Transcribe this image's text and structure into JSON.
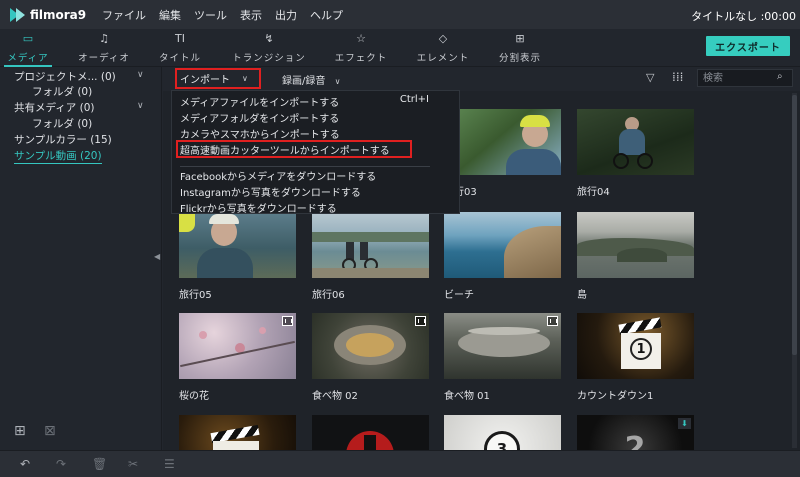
{
  "app": {
    "logo_text": "filmora9",
    "doc_title": "タイトルなし :00:00",
    "menu": [
      "ファイル",
      "編集",
      "ツール",
      "表示",
      "出力",
      "ヘルプ"
    ]
  },
  "tabs": [
    {
      "label": "メディア",
      "icon": "▭",
      "active": true
    },
    {
      "label": "オーディオ",
      "icon": "♫",
      "active": false
    },
    {
      "label": "タイトル",
      "icon": "TI",
      "active": false
    },
    {
      "label": "トランジション",
      "icon": "↯",
      "active": false
    },
    {
      "label": "エフェクト",
      "icon": "☆",
      "active": false
    },
    {
      "label": "エレメント",
      "icon": "◇",
      "active": false
    },
    {
      "label": "分割表示",
      "icon": "⊞",
      "active": false
    }
  ],
  "export_label": "エクスポート",
  "sidebar": {
    "items": [
      {
        "label": "プロジェクトメ... (0)",
        "caret": "∨"
      },
      {
        "label": "フォルダ (0)"
      },
      {
        "label": "共有メディア (0)",
        "caret": "∨"
      },
      {
        "label": "フォルダ (0)"
      },
      {
        "label": "サンプルカラー (15)"
      },
      {
        "label": "サンプル動画 (20)",
        "selected": true
      }
    ],
    "add_folder_icon": "⊞",
    "remove_folder_icon": "⊠"
  },
  "content_bar": {
    "import_label": "インポート",
    "record_label": "録画/録音",
    "search_placeholder": "検索"
  },
  "import_menu": {
    "items": [
      "メディアファイルをインポートする",
      "メディアフォルダをインポートする",
      "カメラやスマホからインポートする",
      "超高速動画カッターツールからインポートする",
      "Facebookからメディアをダウンロードする",
      "Instagramから写真をダウンロードする",
      "Flickrから写真をダウンロードする"
    ],
    "shortcut": "Ctrl+I"
  },
  "media": [
    {
      "caption": "",
      "row": 0,
      "col": 0
    },
    {
      "caption": "",
      "row": 0,
      "col": 1
    },
    {
      "caption": "旅行03",
      "row": 0,
      "col": 2
    },
    {
      "caption": "旅行04",
      "row": 0,
      "col": 3
    },
    {
      "caption": "旅行05",
      "row": 1,
      "col": 0
    },
    {
      "caption": "旅行06",
      "row": 1,
      "col": 1
    },
    {
      "caption": "ビーチ",
      "row": 1,
      "col": 2
    },
    {
      "caption": "島",
      "row": 1,
      "col": 3
    },
    {
      "caption": "桜の花",
      "row": 2,
      "col": 0
    },
    {
      "caption": "食べ物 02",
      "row": 2,
      "col": 1
    },
    {
      "caption": "食べ物 01",
      "row": 2,
      "col": 2
    },
    {
      "caption": "カウントダウン1",
      "row": 2,
      "col": 3
    },
    {
      "caption": "",
      "row": 3,
      "col": 0
    },
    {
      "caption": "",
      "row": 3,
      "col": 1
    },
    {
      "caption": "",
      "row": 3,
      "col": 2
    },
    {
      "caption": "",
      "row": 3,
      "col": 3
    }
  ],
  "bottom_icons": [
    "undo-icon",
    "redo-icon",
    "delete-icon",
    "cut-icon",
    "adjust-icon"
  ],
  "colors": {
    "accent": "#35c6c0",
    "highlight": "#e02020",
    "background": "#22262d"
  }
}
